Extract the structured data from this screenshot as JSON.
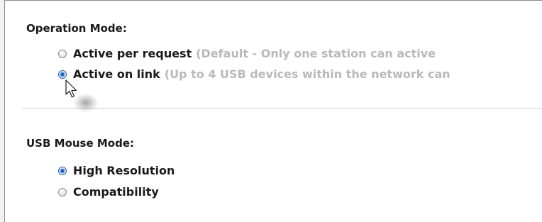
{
  "operation_mode": {
    "title": "Operation Mode:",
    "options": [
      {
        "label": "Active per request",
        "description": "(Default - Only one station can active",
        "checked": false
      },
      {
        "label": "Active on link",
        "description": "(Up to 4 USB devices within the network can",
        "checked": true
      }
    ]
  },
  "usb_mouse_mode": {
    "title": "USB Mouse Mode:",
    "options": [
      {
        "label": "High Resolution",
        "checked": true
      },
      {
        "label": "Compatibility",
        "checked": false
      }
    ]
  },
  "icons": {
    "cursor": "arrow-pointer-icon"
  }
}
